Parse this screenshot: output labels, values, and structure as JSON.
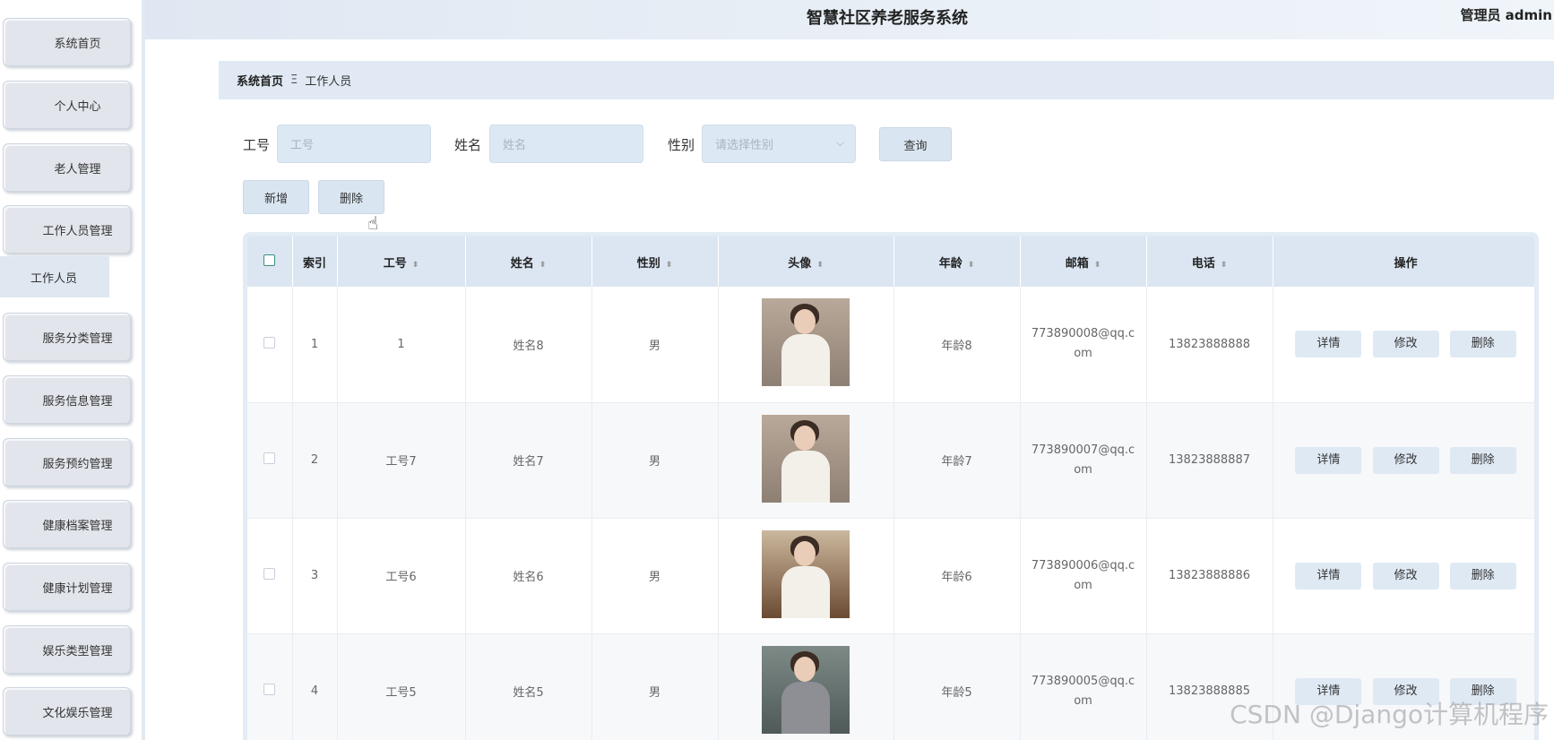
{
  "header": {
    "title": "智慧社区养老服务系统",
    "user": "管理员 admin"
  },
  "sidebar": {
    "items": [
      {
        "label": "系统首页"
      },
      {
        "label": "个人中心"
      },
      {
        "label": "老人管理"
      },
      {
        "label": "工作人员管理"
      },
      {
        "label": "服务分类管理"
      },
      {
        "label": "服务信息管理"
      },
      {
        "label": "服务预约管理"
      },
      {
        "label": "健康档案管理"
      },
      {
        "label": "健康计划管理"
      },
      {
        "label": "娱乐类型管理"
      },
      {
        "label": "文化娱乐管理"
      }
    ],
    "active_sub": "工作人员"
  },
  "breadcrumb": {
    "home": "系统首页",
    "separator": "Ξ",
    "current": "工作人员"
  },
  "search": {
    "id_label": "工号",
    "id_placeholder": "工号",
    "name_label": "姓名",
    "name_placeholder": "姓名",
    "gender_label": "性别",
    "gender_placeholder": "请选择性别",
    "query_button": "查询"
  },
  "actions": {
    "add": "新增",
    "delete": "删除"
  },
  "table": {
    "columns": [
      "索引",
      "工号",
      "姓名",
      "性别",
      "头像",
      "年龄",
      "邮箱",
      "电话",
      "操作"
    ],
    "rows": [
      {
        "index": "1",
        "id": "1",
        "name": "姓名8",
        "gender": "男",
        "age": "年龄8",
        "email": "773890008@qq.com",
        "phone": "13823888888"
      },
      {
        "index": "2",
        "id": "工号7",
        "name": "姓名7",
        "gender": "男",
        "age": "年龄7",
        "email": "773890007@qq.com",
        "phone": "13823888887"
      },
      {
        "index": "3",
        "id": "工号6",
        "name": "姓名6",
        "gender": "男",
        "age": "年龄6",
        "email": "773890006@qq.com",
        "phone": "13823888886"
      },
      {
        "index": "4",
        "id": "工号5",
        "name": "姓名5",
        "gender": "男",
        "age": "年龄5",
        "email": "773890005@qq.com",
        "phone": "13823888885"
      }
    ],
    "row_actions": {
      "detail": "详情",
      "edit": "修改",
      "delete": "删除"
    }
  },
  "watermark": "CSDN @Django计算机程序"
}
